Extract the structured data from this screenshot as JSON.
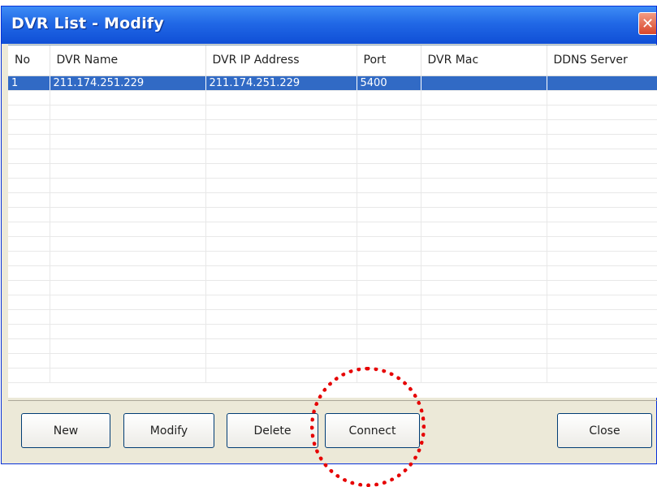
{
  "window": {
    "title": "DVR List - Modify",
    "close_glyph": "✕"
  },
  "table": {
    "columns": [
      "No",
      "DVR Name",
      "DVR IP Address",
      "Port",
      "DVR Mac",
      "DDNS Server"
    ],
    "rows": [
      [
        "1",
        "211.174.251.229",
        "211.174.251.229",
        "5400",
        "",
        ""
      ]
    ],
    "selected_row": 0,
    "empty_row_count": 20
  },
  "buttons": {
    "new": "New",
    "modify": "Modify",
    "delete": "Delete",
    "connect": "Connect",
    "close": "Close"
  },
  "colors": {
    "title_bar": "#2168e6",
    "selection": "#316ac5",
    "highlight_circle": "#e60000"
  }
}
